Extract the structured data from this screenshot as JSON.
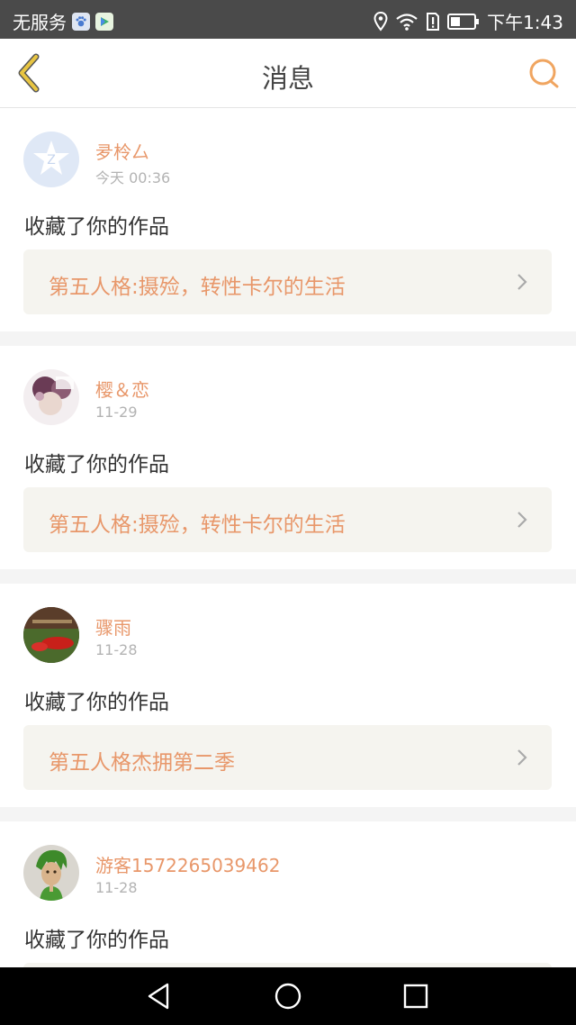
{
  "status_bar": {
    "carrier": "无服务",
    "time": "下午1:43",
    "icons": [
      "baidu-paw-icon",
      "play-store-icon",
      "location-icon",
      "wifi-icon",
      "sim-alert-icon",
      "battery-icon"
    ]
  },
  "header": {
    "title": "消息",
    "back_icon": "chevron-left-icon",
    "search_icon": "search-icon"
  },
  "colors": {
    "accent": "#e8976a",
    "back_icon": "#e8c542",
    "card_bg": "#f5f4ef"
  },
  "messages": [
    {
      "user": "夛柃厶",
      "time": "今天 00:36",
      "action": "收藏了你的作品",
      "work": "第五人格:摄殓，转性卡尔的生活"
    },
    {
      "user": "樱＆恋",
      "time": "11-29",
      "action": "收藏了你的作品",
      "work": "第五人格:摄殓，转性卡尔的生活"
    },
    {
      "user": "骤雨",
      "time": "11-28",
      "action": "收藏了你的作品",
      "work": "第五人格杰拥第二季"
    },
    {
      "user": "游客1572265039462",
      "time": "11-28",
      "action": "收藏了你的作品",
      "work": ""
    }
  ],
  "system_nav": [
    "back-key-icon",
    "home-key-icon",
    "recents-key-icon"
  ]
}
